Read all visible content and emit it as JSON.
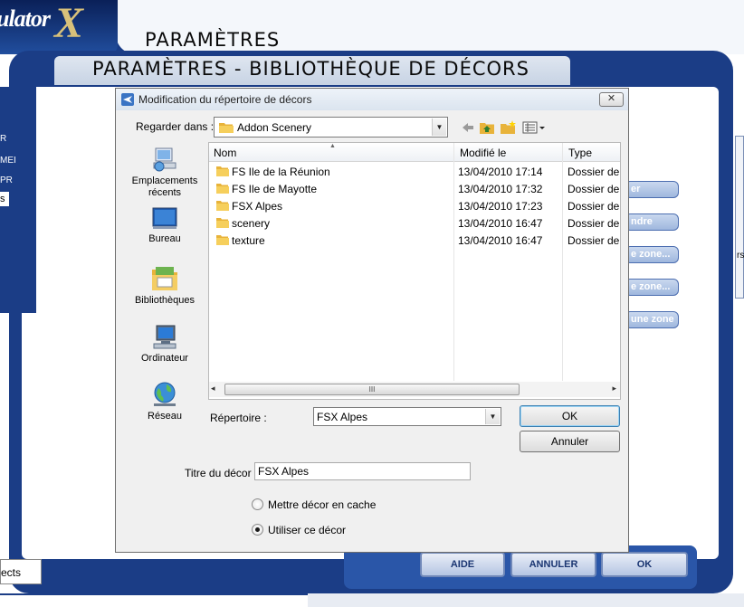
{
  "background": {
    "app_logo_text": "ulator",
    "app_logo_x": "X",
    "section_title": "PARAMÈTRES",
    "window_title": "PARAMÈTRES - BIBLIOTHÈQUE DE DÉCORS",
    "left_labels": [
      "R",
      "MEI",
      "PR"
    ],
    "left_box_text": "s",
    "side_buttons": [
      "er",
      "ndre",
      "e zone...",
      "e zone...",
      "une zone"
    ],
    "right_edge_text": "rs",
    "bottom_left_text": "ects",
    "bottom_buttons": {
      "help": "AIDE",
      "cancel": "ANNULER",
      "ok": "OK"
    },
    "colors": {
      "brand_blue": "#1b3d86",
      "accent_blue": "#2a56a8"
    }
  },
  "dialog": {
    "title": "Modification du répertoire de décors",
    "close_symbol": "✕",
    "look_in": {
      "label": "Regarder dans :",
      "value": "Addon Scenery"
    },
    "toolbar_icons": [
      "back-arrow-icon",
      "up-folder-icon",
      "new-folder-icon",
      "view-menu-icon"
    ],
    "places": [
      {
        "label": "Emplacements récents",
        "icon": "recent-places-icon"
      },
      {
        "label": "Bureau",
        "icon": "desktop-icon"
      },
      {
        "label": "Bibliothèques",
        "icon": "libraries-icon"
      },
      {
        "label": "Ordinateur",
        "icon": "computer-icon"
      },
      {
        "label": "Réseau",
        "icon": "network-icon"
      }
    ],
    "columns": {
      "name": "Nom",
      "modified": "Modifié le",
      "type": "Type"
    },
    "files": [
      {
        "name": "FS Ile de la Réunion",
        "modified": "13/04/2010 17:14",
        "type": "Dossier de f"
      },
      {
        "name": "FS Ile de Mayotte",
        "modified": "13/04/2010 17:32",
        "type": "Dossier de f"
      },
      {
        "name": "FSX Alpes",
        "modified": "13/04/2010 17:23",
        "type": "Dossier de f"
      },
      {
        "name": "scenery",
        "modified": "13/04/2010 16:47",
        "type": "Dossier de f"
      },
      {
        "name": "texture",
        "modified": "13/04/2010 16:47",
        "type": "Dossier de f"
      }
    ],
    "scrollbar": {
      "left_arrow": "◂",
      "right_arrow": "▸",
      "grip": "III"
    },
    "directory": {
      "label": "Répertoire :",
      "value": "FSX Alpes"
    },
    "ok_label": "OK",
    "cancel_label": "Annuler",
    "scenery_title": {
      "label": "Titre du décor :",
      "value": "FSX Alpes"
    },
    "options": [
      {
        "label": "Mettre décor en cache",
        "selected": false
      },
      {
        "label": "Utiliser ce décor",
        "selected": true
      }
    ]
  }
}
